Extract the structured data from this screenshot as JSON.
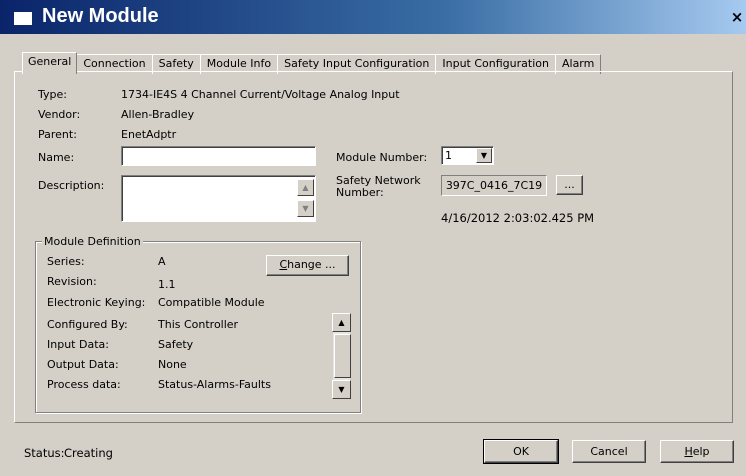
{
  "window": {
    "title": "New Module",
    "close_glyph": "×"
  },
  "tabs": [
    {
      "label": "General"
    },
    {
      "label": "Connection"
    },
    {
      "label": "Safety"
    },
    {
      "label": "Module Info"
    },
    {
      "label": "Safety Input Configuration"
    },
    {
      "label": "Input Configuration"
    },
    {
      "label": "Alarm"
    }
  ],
  "general": {
    "type_label": "Type:",
    "type_value": "1734-IE4S 4 Channel Current/Voltage Analog Input",
    "vendor_label": "Vendor:",
    "vendor_value": "Allen-Bradley",
    "parent_label": "Parent:",
    "parent_value": "EnetAdptr",
    "name_label": "Name:",
    "name_value": "",
    "description_label": "Description:",
    "description_value": "",
    "module_number_label": "Module Number:",
    "module_number_value": "1",
    "safety_network_label_1": "Safety Network",
    "safety_network_label_2": "Number:",
    "safety_network_value": "397C_0416_7C19",
    "browse_label": "...",
    "timestamp": "4/16/2012 2:03:02.425 PM"
  },
  "module_definition": {
    "title": "Module Definition",
    "change_button": "Change ...",
    "rows": [
      {
        "label": "Series:",
        "value": "A"
      },
      {
        "label": "Revision:",
        "value": "1.1"
      },
      {
        "label": "Electronic Keying:",
        "value": "Compatible Module"
      },
      {
        "label": "Configured By:",
        "value": "This Controller"
      },
      {
        "label": "Input Data:",
        "value": "Safety"
      },
      {
        "label": "Output Data:",
        "value": "None"
      },
      {
        "label": "Process data:",
        "value": "Status-Alarms-Faults"
      }
    ]
  },
  "footer": {
    "status_label": "Status:",
    "status_value": "Creating",
    "ok_button": "OK",
    "cancel_button": "Cancel",
    "help_button": "Help"
  }
}
